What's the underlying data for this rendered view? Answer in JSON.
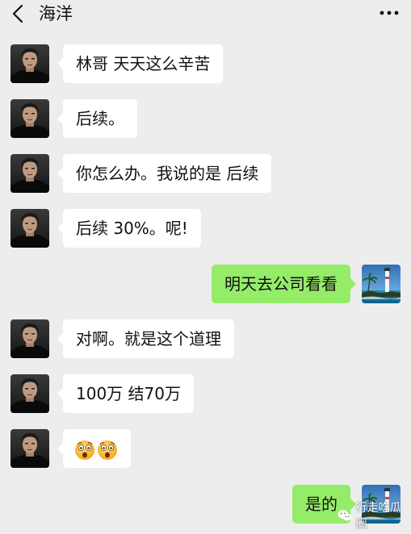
{
  "colors": {
    "background": "#ededed",
    "incoming_bubble": "#ffffff",
    "outgoing_bubble": "#95ec69",
    "text": "#111111"
  },
  "header": {
    "back_icon": "chevron-left-icon",
    "title": "海洋",
    "more_icon": "more-dots-icon"
  },
  "messages": [
    {
      "side": "in",
      "text": "林哥 天天这么辛苦"
    },
    {
      "side": "in",
      "text": "后续。"
    },
    {
      "side": "in",
      "text": "你怎么办。我说的是 后续"
    },
    {
      "side": "in",
      "text": "后续 30%。呢!"
    },
    {
      "side": "out",
      "text": "明天去公司看看"
    },
    {
      "side": "in",
      "text": "对啊。就是这个道理"
    },
    {
      "side": "in",
      "text": "100万 结70万"
    },
    {
      "side": "in",
      "emoji": [
        "astonished-face-emoji",
        "astonished-face-emoji"
      ]
    },
    {
      "side": "out",
      "text": "是的"
    }
  ],
  "watermark": {
    "icon": "wechat-icon",
    "text": "行走吃瓜圈"
  }
}
